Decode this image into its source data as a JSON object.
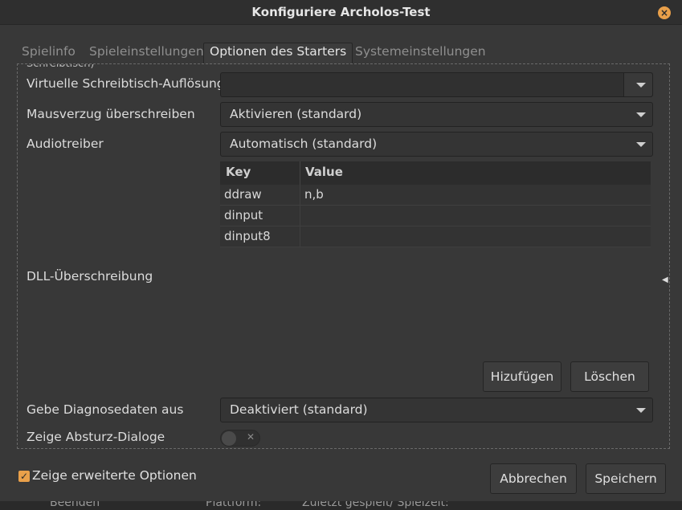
{
  "window": {
    "title": "Konfiguriere Archolos-Test"
  },
  "tabs": [
    {
      "label": "Spielinfo"
    },
    {
      "label": "Spieleinstellungen"
    },
    {
      "label": "Optionen des Starters"
    },
    {
      "label": "Systemeinstellungen"
    }
  ],
  "cut_label": "Schreibtisch)",
  "settings": {
    "virtual_desktop": {
      "label": "Virtuelle Schreibtisch-Auflösung",
      "value": ""
    },
    "mouse_warp": {
      "label": "Mausverzug überschreiben",
      "value": "Aktivieren (standard)"
    },
    "audio_driver": {
      "label": "Audiotreiber",
      "value": "Automatisch (standard)"
    },
    "dll_override": {
      "label": "DLL-Überschreibung",
      "columns": {
        "key": "Key",
        "value": "Value"
      },
      "rows": [
        {
          "key": "ddraw",
          "value": "n,b"
        },
        {
          "key": "dinput",
          "value": ""
        },
        {
          "key": "dinput8",
          "value": ""
        }
      ],
      "add_label": "Hizufügen",
      "delete_label": "Löschen"
    },
    "debug_output": {
      "label": "Gebe Diagnosedaten aus",
      "value": "Deaktiviert (standard)"
    },
    "crash_dialogs": {
      "label": "Zeige Absturz-Dialoge",
      "enabled": false
    }
  },
  "footer": {
    "advanced_label": "Zeige erweiterte Optionen",
    "advanced_checked": true,
    "cancel_label": "Abbrechen",
    "save_label": "Speichern"
  },
  "background": {
    "item1": "Beenden",
    "item2": "Plattform:",
    "item3": "Zuletzt gespielt/ Spielzeit:"
  },
  "icons": {
    "close": "close-icon",
    "check": "check-icon",
    "dropdown": "chevron-down-icon"
  },
  "colors": {
    "accent": "#e9a04a",
    "background": "#383838"
  }
}
